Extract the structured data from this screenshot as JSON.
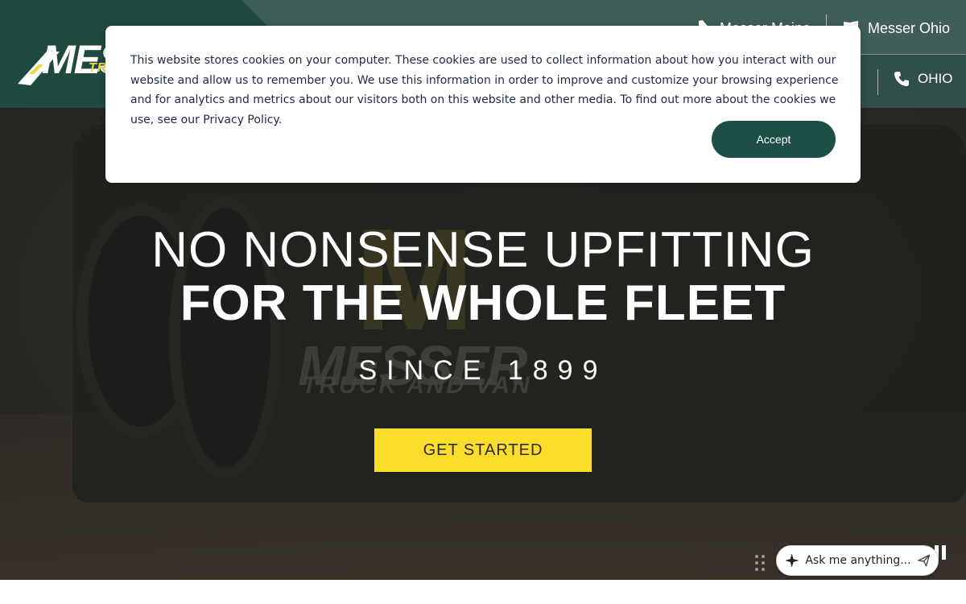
{
  "header": {
    "logo_text": "MESSER",
    "logo_sub": "TRUCK",
    "locations": [
      {
        "label": "Messer Maine",
        "icon": "maine-state-icon"
      },
      {
        "label": "Messer Ohio",
        "icon": "ohio-state-icon"
      }
    ],
    "phone": {
      "label": "OHIO",
      "icon": "phone-icon"
    }
  },
  "hero": {
    "title_line1": "NO NONSENSE UPFITTING",
    "title_line2": "FOR THE WHOLE FLEET",
    "since": "SINCE 1899",
    "cta_label": "GET STARTED",
    "background_mark": "MESSER",
    "background_mark_sub": "TRUCK AND VAN",
    "background_letter": "M"
  },
  "cookie_dialog": {
    "text": "This website stores cookies on your computer. These cookies are used to collect information about how you interact with our website and allow us to remember you. We use this information in order to improve and customize your browsing experience and for analytics and metrics about our visitors both on this website and other media. To find out more about the cookies we use, see our Privacy Policy.",
    "accept_label": "Accept"
  },
  "chat": {
    "placeholder": "Ask me anything...",
    "icon": "sparkle-icon",
    "send_icon": "send-icon"
  },
  "colors": {
    "header_green": "#2f4f48",
    "accent_yellow": "#fbdd2c",
    "accept_green": "#1e4f47"
  }
}
